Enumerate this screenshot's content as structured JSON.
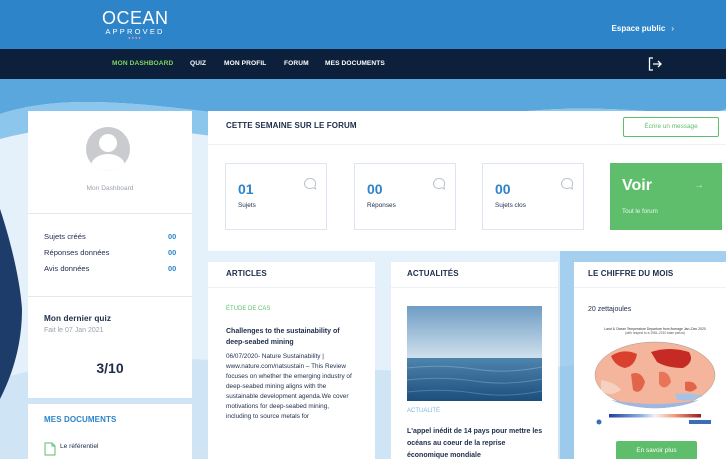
{
  "header": {
    "logo_main": "OCEAN",
    "logo_sub": "APPROVED",
    "espace": "Espace public",
    "espace_chevron": "›"
  },
  "nav": {
    "items": [
      "MON DASHBOARD",
      "QUIZ",
      "MON PROFIL",
      "FORUM",
      "MES DOCUMENTS"
    ],
    "active_index": 0
  },
  "profile": {
    "name": "Mon Dashboard",
    "stats": [
      {
        "label": "Sujets créés",
        "value": "00"
      },
      {
        "label": "Réponses données",
        "value": "00"
      },
      {
        "label": "Avis données",
        "value": "00"
      }
    ]
  },
  "quiz": {
    "title": "Mon dernier quiz",
    "date": "Fait le 07 Jan 2021",
    "score": "3/10"
  },
  "documents": {
    "title": "MES DOCUMENTS",
    "items": [
      "Le référentiel"
    ]
  },
  "forum": {
    "title": "CETTE SEMAINE SUR LE FORUM",
    "write_button": "Écrire un message",
    "stats": [
      {
        "value": "01",
        "label": "Sujets"
      },
      {
        "value": "00",
        "label": "Réponses"
      },
      {
        "value": "00",
        "label": "Sujets clos"
      }
    ],
    "voir": "Voir",
    "voir_sub": "Tout le forum",
    "voir_arrow": "→"
  },
  "articles": {
    "title": "ARTICLES",
    "category": "ÉTUDE DE CAS",
    "headline": "Challenges to the sustainability of deep-seabed mining",
    "text": "06/07/2020- Nature Sustainability | www.nature.com/natsustain – This Review focuses on whether the emerging industry of deep-seabed mining aligns with the sustainable development agenda.We cover motivations for deep-seabed mining, including to source metals for"
  },
  "actualites": {
    "title": "ACTUALITÉS",
    "category": "ACTUALITÉ",
    "headline": "L'appel inédit de 14 pays pour mettre les océans au coeur de la reprise économique mondiale"
  },
  "chiffre": {
    "title": "LE CHIFFRE DU MOIS",
    "value": "20 zettajoules",
    "map_title": "Land & Ocean Temperature Departure from Average Jan–Dec 2020",
    "map_subtitle": "(with respect to a 1981–2010 base period)",
    "button": "En savoir plus"
  },
  "icons": [
    "logout-icon",
    "user-avatar-icon",
    "chat-bubble-icon",
    "file-document-icon",
    "arrow-right-icon"
  ],
  "colors": {
    "primary": "#2d84c9",
    "navy": "#0c1f3b",
    "green": "#5ebe6c",
    "accent": "#7fd35f"
  }
}
